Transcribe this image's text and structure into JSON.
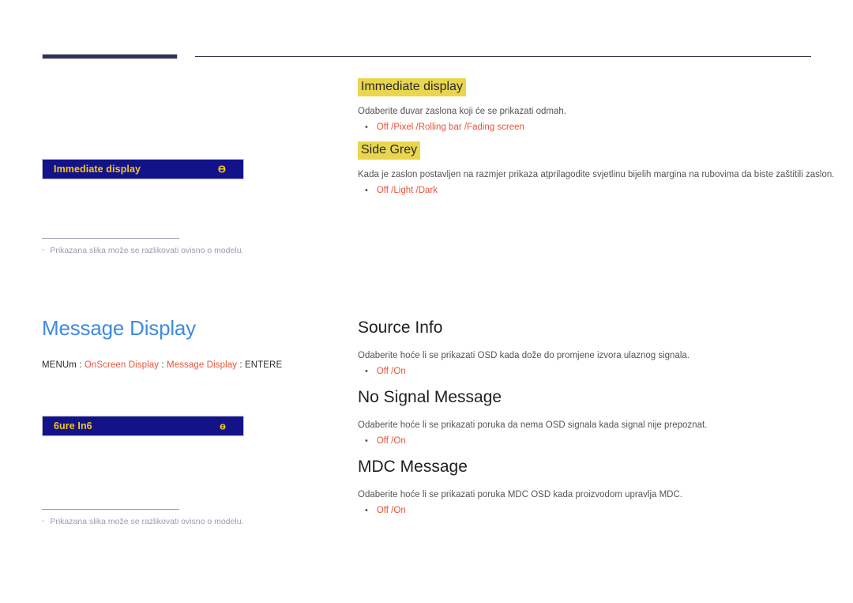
{
  "page": {
    "language": "hr"
  },
  "top_rule": {
    "present": true,
    "accent_color": "#2f3356"
  },
  "colors": {
    "accent_blue": "#3f8ae0",
    "highlight_yellow": "#e9d64e",
    "option_red": "#e8553a",
    "osd_box_bg": "#131389",
    "osd_box_text": "#f5c518",
    "note_grey": "#9a9ab4"
  },
  "section_one": {
    "osd_box": {
      "label": "Immediate display",
      "glyph": "Ө"
    },
    "note": {
      "dash": "-",
      "text": "Prikazana slika može se razlikovati ovisno o modelu."
    },
    "entries": [
      {
        "heading": "Immediate display",
        "heading_style": "highlight",
        "description": "Odaberite đuvar zaslona koji će se prikazati odmah.",
        "options": "Off /Pixel /Rolling bar /Fading screen"
      },
      {
        "heading": "Side Grey",
        "heading_style": "highlight",
        "description": "Kada je zaslon postavljen na razmjer prikaza ațprilagodite svjetlinu bijelih margina na rubovima da biste zaštitili zaslon.",
        "options": "Off /Light /Dark"
      }
    ]
  },
  "section_two": {
    "title": "Message Display",
    "menu_path": {
      "prefix": "MENUm",
      "sep": ":",
      "level_one": "OnScreen Display",
      "level_two": "Message Display",
      "suffix": "ENTERE"
    },
    "osd_box": {
      "label": "6ure In6",
      "glyph": "ө"
    },
    "note": {
      "dash": "-",
      "text": "Prikazana slika može se razlikovati ovisno o modelu."
    },
    "entries": [
      {
        "heading": "Source Info",
        "heading_style": "plain",
        "description": "Odaberite hoće li se prikazati OSD kada dože do promjene izvora ulaznog signala.",
        "options": "Off /On"
      },
      {
        "heading": "No Signal Message",
        "heading_style": "plain",
        "description": "Odaberite hoće li se prikazati poruka da nema OSD signala kada signal nije prepoznat.",
        "options": "Off /On"
      },
      {
        "heading": "MDC Message",
        "heading_style": "plain",
        "description": "Odaberite hoće li se prikazati poruka MDC OSD kada proizvodom upravlja MDC.",
        "options": "Off /On"
      }
    ]
  },
  "bullet_glyph": "•"
}
